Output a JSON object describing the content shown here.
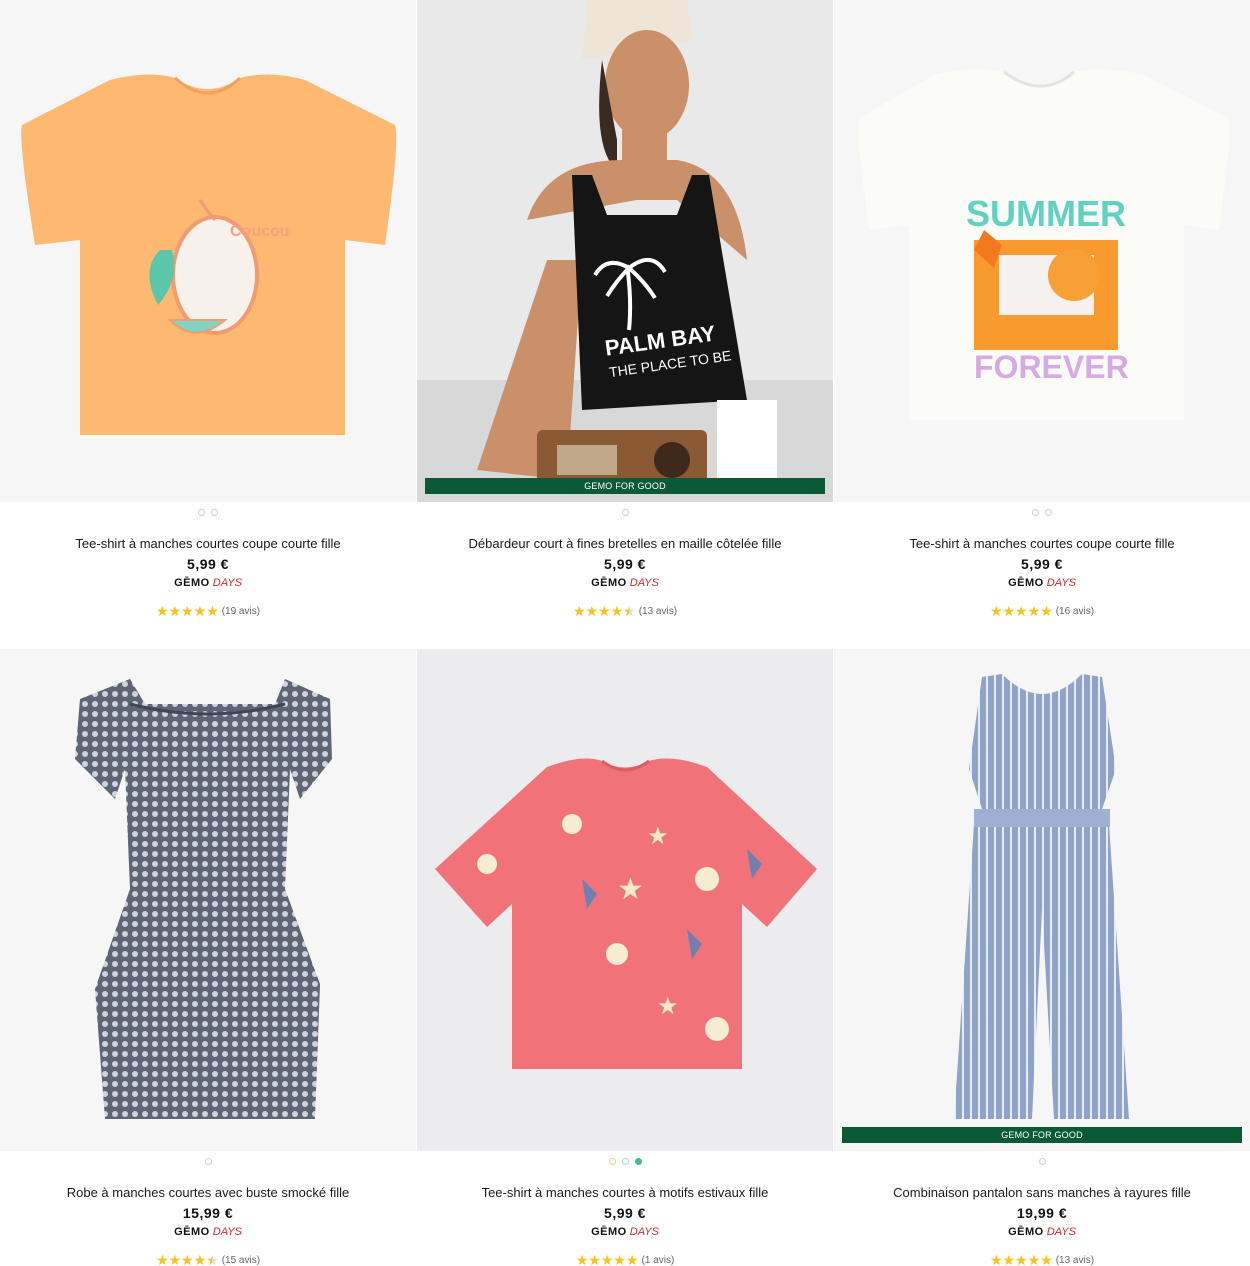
{
  "colors": {
    "rating_star": "#f5c518",
    "badge_bg": "#0b5a36",
    "days_red": "#d22a2a",
    "dot_active": "#3fbf8a"
  },
  "icons": {
    "rating": "star-icon"
  },
  "products": [
    {
      "title": "Tee-shirt à manches courtes coupe courte fille",
      "price": "5,99 €",
      "brand": "GĒMO",
      "days": "DAYS",
      "rating": 5,
      "reviews": "(19 avis)",
      "badge": "",
      "dots": 2,
      "active_dot": -1,
      "image": "orange-tshirt-fruit-print"
    },
    {
      "title": "Débardeur court à fines bretelles en maille côtelée fille",
      "price": "5,99 €",
      "brand": "GĒMO",
      "days": "DAYS",
      "rating": 4.5,
      "reviews": "(13 avis)",
      "badge": "GEMO FOR GOOD",
      "dots": 1,
      "active_dot": -1,
      "image": "girl-black-tank-top-palm-bay",
      "print_text": [
        "PALM BAY",
        "THE PLACE TO BE"
      ]
    },
    {
      "title": "Tee-shirt à manches courtes coupe courte fille",
      "price": "5,99 €",
      "brand": "GĒMO",
      "days": "DAYS",
      "rating": 5,
      "reviews": "(16 avis)",
      "badge": "",
      "dots": 2,
      "active_dot": -1,
      "image": "white-tshirt-summer-forever",
      "print_text": [
        "SUMMER",
        "FOREVER"
      ]
    },
    {
      "title": "Robe à manches courtes avec buste smocké fille",
      "price": "15,99 €",
      "brand": "GĒMO",
      "days": "DAYS",
      "rating": 4.5,
      "reviews": "(15 avis)",
      "badge": "",
      "dots": 1,
      "active_dot": -1,
      "image": "navy-patterned-smocked-dress"
    },
    {
      "title": "Tee-shirt à manches courtes à motifs estivaux fille",
      "price": "5,99 €",
      "brand": "GĒMO",
      "days": "DAYS",
      "rating": 5,
      "reviews": "(1 avis)",
      "badge": "",
      "dots": 3,
      "active_dot": 2,
      "image": "pink-tshirt-sea-shells"
    },
    {
      "title": "Combinaison pantalon sans manches à rayures fille",
      "price": "19,99 €",
      "brand": "GĒMO",
      "days": "DAYS",
      "rating": 5,
      "reviews": "(13 avis)",
      "badge": "GEMO FOR GOOD",
      "dots": 1,
      "active_dot": -1,
      "image": "blue-striped-jumpsuit"
    }
  ]
}
